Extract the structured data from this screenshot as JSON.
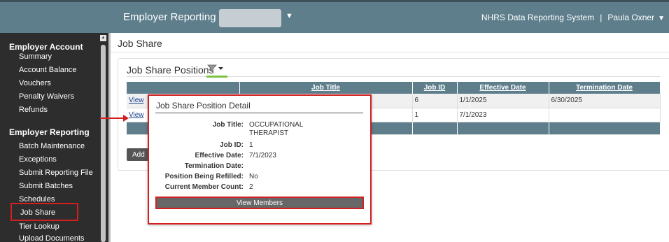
{
  "header": {
    "menu_title": "Employer Reporting",
    "system_name": "NHRS Data Reporting System",
    "separator": "|",
    "user_name": "Paula Oxner"
  },
  "sidebar": {
    "sections": [
      {
        "heading": "Employer Account",
        "items": [
          "Summary",
          "Account Balance",
          "Vouchers",
          "Penalty Waivers",
          "Refunds"
        ]
      },
      {
        "heading": "Employer Reporting",
        "items": [
          "Batch Maintenance",
          "Exceptions",
          "Submit Reporting File",
          "Submit Batches",
          "Schedules",
          "Job Share",
          "Tier Lookup",
          "Upload Documents"
        ]
      }
    ],
    "active_item": "Job Share"
  },
  "page": {
    "title": "Job Share",
    "panel_title": "Job Share Positions"
  },
  "table": {
    "columns": [
      "",
      "Job Title",
      "Job ID",
      "Effective Date",
      "Termination Date"
    ],
    "rows": [
      {
        "link": "View",
        "job_title": "",
        "job_id": "6",
        "effective_date": "1/1/2025",
        "termination_date": "6/30/2025"
      },
      {
        "link": "View",
        "job_title": "",
        "job_id": "1",
        "effective_date": "7/1/2023",
        "termination_date": ""
      }
    ]
  },
  "add_button": "Add",
  "popup": {
    "title": "Job Share Position Detail",
    "fields": [
      {
        "label": "Job Title:",
        "value": "OCCUPATIONAL THERAPIST"
      },
      {
        "label": "Job ID:",
        "value": "1"
      },
      {
        "label": "Effective Date:",
        "value": "7/1/2023"
      },
      {
        "label": "Termination Date:",
        "value": ""
      },
      {
        "label": "Position Being Refilled:",
        "value": "No"
      },
      {
        "label": "Current Member Count:",
        "value": "2"
      }
    ],
    "button": "View Members"
  },
  "colors": {
    "header_bg": "#5e7e8c",
    "sidebar_bg": "#2d2d2d",
    "highlight": "#d22020",
    "accent_green": "#7dc242"
  }
}
